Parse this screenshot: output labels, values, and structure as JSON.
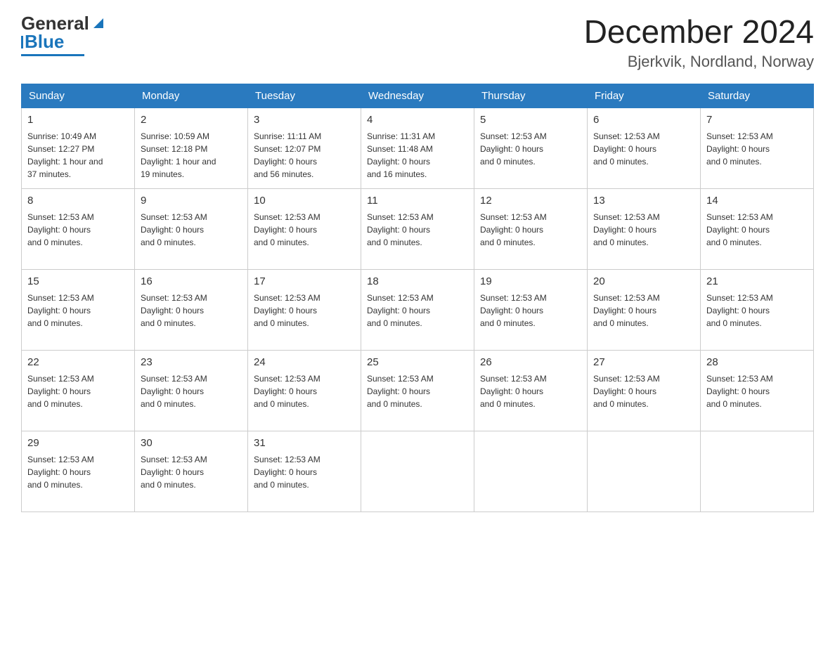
{
  "logo": {
    "text_general": "General",
    "text_blue": "Blue"
  },
  "header": {
    "month_year": "December 2024",
    "location": "Bjerkvik, Nordland, Norway"
  },
  "weekdays": [
    "Sunday",
    "Monday",
    "Tuesday",
    "Wednesday",
    "Thursday",
    "Friday",
    "Saturday"
  ],
  "weeks": [
    [
      {
        "day": "1",
        "info": "Sunrise: 10:49 AM\nSunset: 12:27 PM\nDaylight: 1 hour and\n37 minutes."
      },
      {
        "day": "2",
        "info": "Sunrise: 10:59 AM\nSunset: 12:18 PM\nDaylight: 1 hour and\n19 minutes."
      },
      {
        "day": "3",
        "info": "Sunrise: 11:11 AM\nSunset: 12:07 PM\nDaylight: 0 hours\nand 56 minutes."
      },
      {
        "day": "4",
        "info": "Sunrise: 11:31 AM\nSunset: 11:48 AM\nDaylight: 0 hours\nand 16 minutes."
      },
      {
        "day": "5",
        "info": "Sunset: 12:53 AM\nDaylight: 0 hours\nand 0 minutes."
      },
      {
        "day": "6",
        "info": "Sunset: 12:53 AM\nDaylight: 0 hours\nand 0 minutes."
      },
      {
        "day": "7",
        "info": "Sunset: 12:53 AM\nDaylight: 0 hours\nand 0 minutes."
      }
    ],
    [
      {
        "day": "8",
        "info": "Sunset: 12:53 AM\nDaylight: 0 hours\nand 0 minutes."
      },
      {
        "day": "9",
        "info": "Sunset: 12:53 AM\nDaylight: 0 hours\nand 0 minutes."
      },
      {
        "day": "10",
        "info": "Sunset: 12:53 AM\nDaylight: 0 hours\nand 0 minutes."
      },
      {
        "day": "11",
        "info": "Sunset: 12:53 AM\nDaylight: 0 hours\nand 0 minutes."
      },
      {
        "day": "12",
        "info": "Sunset: 12:53 AM\nDaylight: 0 hours\nand 0 minutes."
      },
      {
        "day": "13",
        "info": "Sunset: 12:53 AM\nDaylight: 0 hours\nand 0 minutes."
      },
      {
        "day": "14",
        "info": "Sunset: 12:53 AM\nDaylight: 0 hours\nand 0 minutes."
      }
    ],
    [
      {
        "day": "15",
        "info": "Sunset: 12:53 AM\nDaylight: 0 hours\nand 0 minutes."
      },
      {
        "day": "16",
        "info": "Sunset: 12:53 AM\nDaylight: 0 hours\nand 0 minutes."
      },
      {
        "day": "17",
        "info": "Sunset: 12:53 AM\nDaylight: 0 hours\nand 0 minutes."
      },
      {
        "day": "18",
        "info": "Sunset: 12:53 AM\nDaylight: 0 hours\nand 0 minutes."
      },
      {
        "day": "19",
        "info": "Sunset: 12:53 AM\nDaylight: 0 hours\nand 0 minutes."
      },
      {
        "day": "20",
        "info": "Sunset: 12:53 AM\nDaylight: 0 hours\nand 0 minutes."
      },
      {
        "day": "21",
        "info": "Sunset: 12:53 AM\nDaylight: 0 hours\nand 0 minutes."
      }
    ],
    [
      {
        "day": "22",
        "info": "Sunset: 12:53 AM\nDaylight: 0 hours\nand 0 minutes."
      },
      {
        "day": "23",
        "info": "Sunset: 12:53 AM\nDaylight: 0 hours\nand 0 minutes."
      },
      {
        "day": "24",
        "info": "Sunset: 12:53 AM\nDaylight: 0 hours\nand 0 minutes."
      },
      {
        "day": "25",
        "info": "Sunset: 12:53 AM\nDaylight: 0 hours\nand 0 minutes."
      },
      {
        "day": "26",
        "info": "Sunset: 12:53 AM\nDaylight: 0 hours\nand 0 minutes."
      },
      {
        "day": "27",
        "info": "Sunset: 12:53 AM\nDaylight: 0 hours\nand 0 minutes."
      },
      {
        "day": "28",
        "info": "Sunset: 12:53 AM\nDaylight: 0 hours\nand 0 minutes."
      }
    ],
    [
      {
        "day": "29",
        "info": "Sunset: 12:53 AM\nDaylight: 0 hours\nand 0 minutes."
      },
      {
        "day": "30",
        "info": "Sunset: 12:53 AM\nDaylight: 0 hours\nand 0 minutes."
      },
      {
        "day": "31",
        "info": "Sunset: 12:53 AM\nDaylight: 0 hours\nand 0 minutes."
      },
      {
        "day": "",
        "info": ""
      },
      {
        "day": "",
        "info": ""
      },
      {
        "day": "",
        "info": ""
      },
      {
        "day": "",
        "info": ""
      }
    ]
  ]
}
